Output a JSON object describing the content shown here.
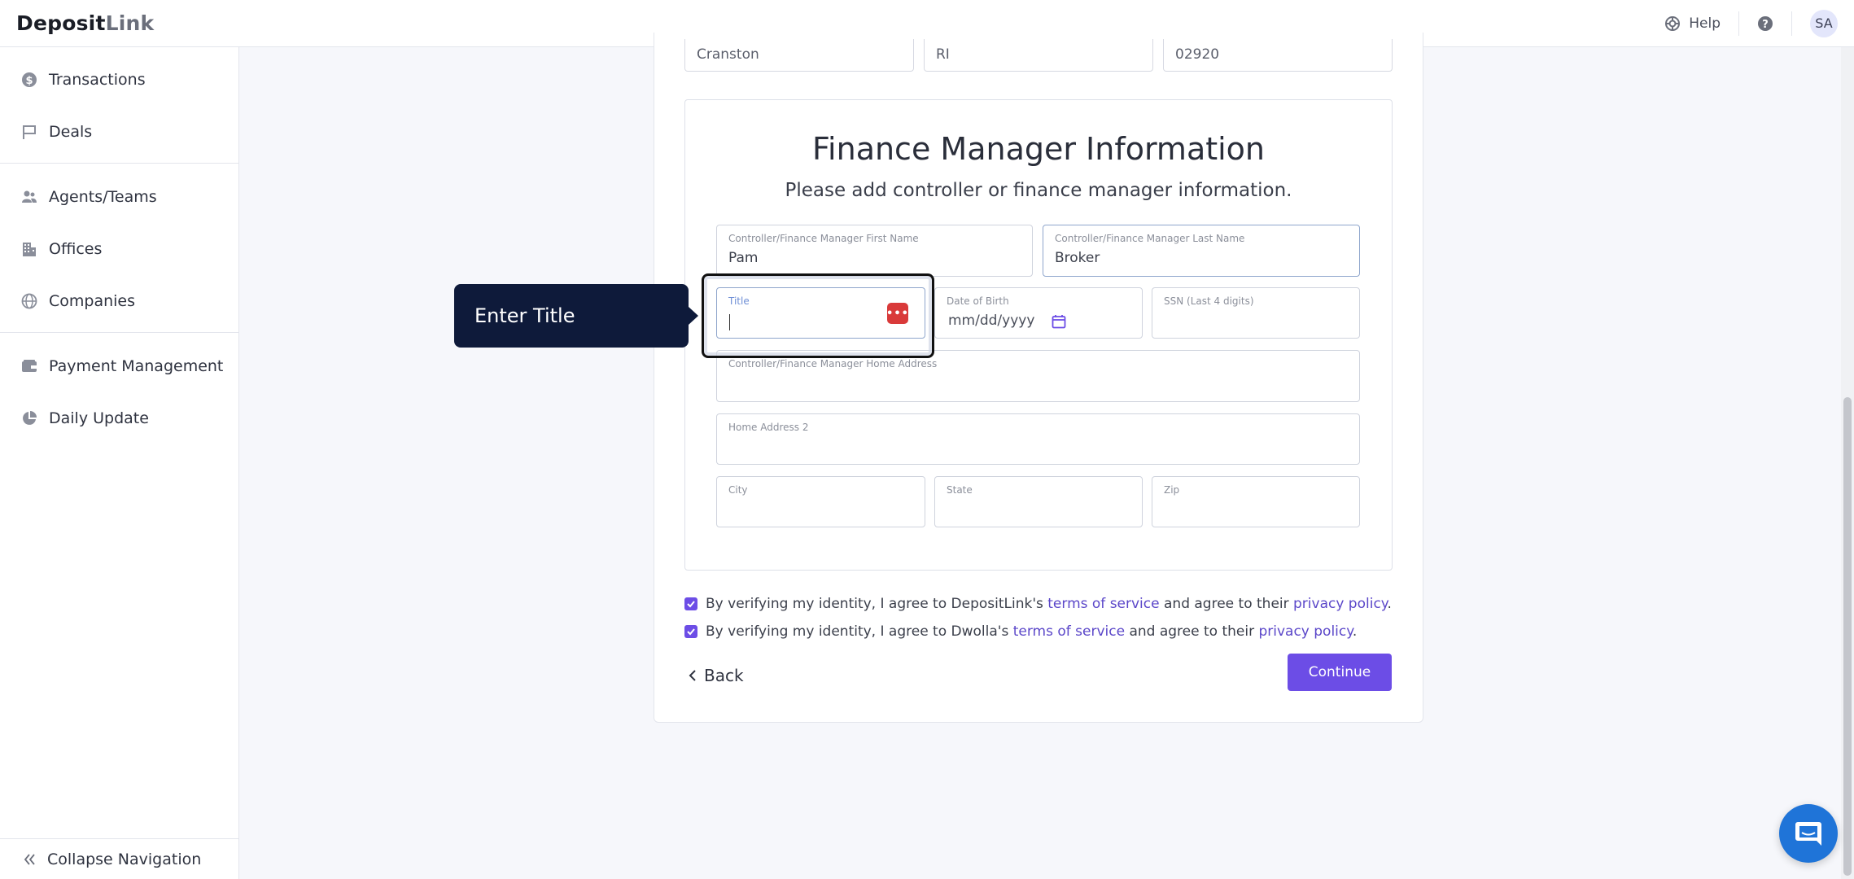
{
  "header": {
    "logo_part1": "Dep",
    "logo_part2": "o",
    "logo_part3": "sit",
    "logo_part4": "Link",
    "help_label": "Help",
    "avatar_initials": "SA"
  },
  "sidebar": {
    "items": [
      {
        "label": "Transactions",
        "icon": "dollar-circle-icon"
      },
      {
        "label": "Deals",
        "icon": "flag-icon"
      },
      {
        "label": "Agents/Teams",
        "icon": "users-icon"
      },
      {
        "label": "Offices",
        "icon": "building-icon"
      },
      {
        "label": "Companies",
        "icon": "globe-icon"
      },
      {
        "label": "Payment Management",
        "icon": "wallet-icon"
      },
      {
        "label": "Daily Update",
        "icon": "pie-chart-icon"
      }
    ],
    "collapse_label": "Collapse Navigation"
  },
  "top_row": {
    "city": "Cranston",
    "state": "RI",
    "zip": "02920"
  },
  "card": {
    "title": "Finance Manager Information",
    "subtitle": "Please add controller or finance manager information.",
    "fields": {
      "first_name_label": "Controller/Finance Manager First Name",
      "first_name_value": "Pam",
      "last_name_label": "Controller/Finance Manager Last Name",
      "last_name_value": "Broker",
      "title_label": "Title",
      "title_value": "",
      "dob_label": "Date of Birth",
      "dob_placeholder": "mm/dd/yyyy",
      "ssn_label": "SSN (Last 4 digits)",
      "home_address_label": "Controller/Finance Manager Home Address",
      "home_address2_label": "Home Address 2",
      "city_label": "City",
      "state_label": "State",
      "zip_label": "Zip"
    }
  },
  "tooltip": {
    "text": "Enter Title"
  },
  "agreements": [
    {
      "prefix": "By verifying my identity, I agree to DepositLink's ",
      "tos": "terms of service",
      "middle": " and agree to their ",
      "privacy": "privacy policy",
      "suffix": "."
    },
    {
      "prefix": "By verifying my identity, I agree to Dwolla's ",
      "tos": "terms of service",
      "middle": " and agree to their ",
      "privacy": "privacy policy",
      "suffix": "."
    }
  ],
  "actions": {
    "back_label": "Back",
    "continue_label": "Continue"
  },
  "colors": {
    "accent": "#6c4de6",
    "tooltip_bg": "#0e1a3a",
    "password_manager": "#d93a3a",
    "chat": "#1f74d8"
  }
}
